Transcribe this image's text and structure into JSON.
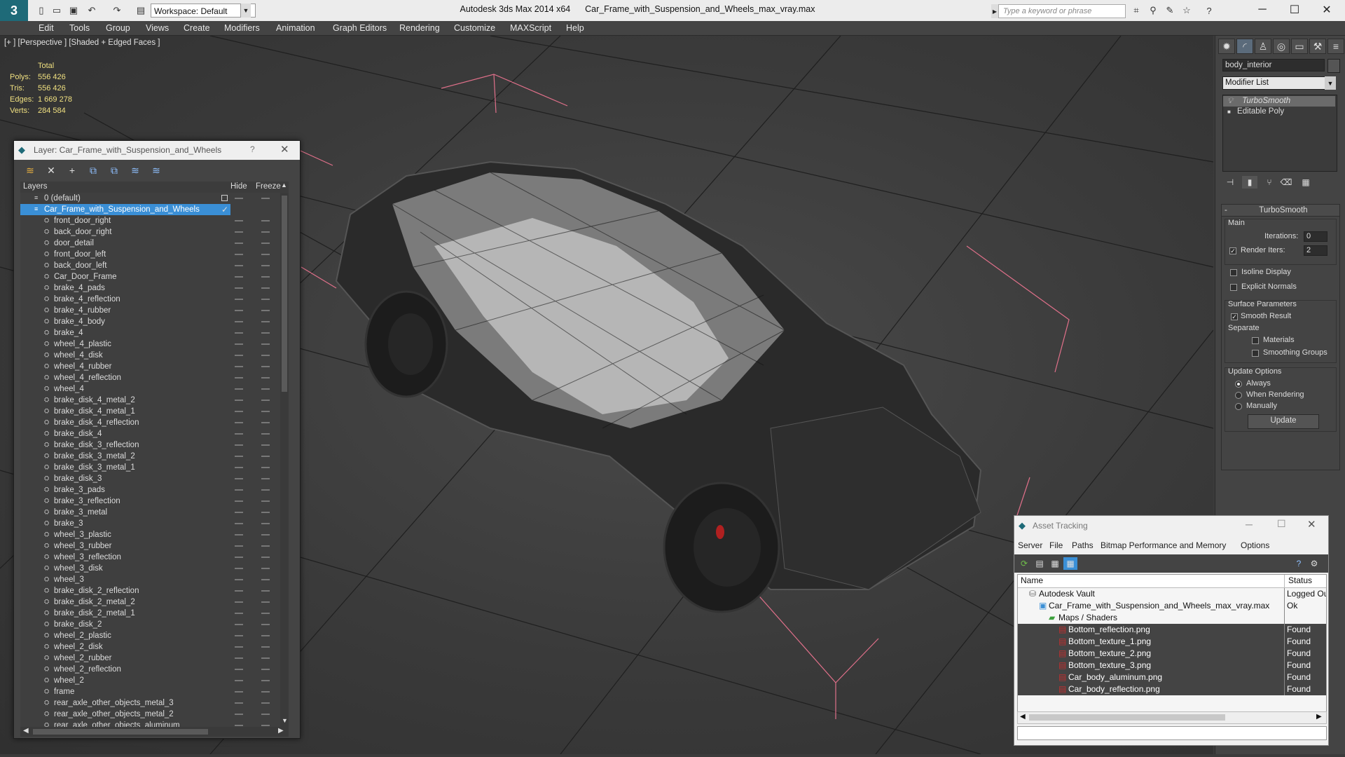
{
  "title_bar": {
    "app_name": "Autodesk 3ds Max  2014 x64",
    "file_name": "Car_Frame_with_Suspension_and_Wheels_max_vray.max",
    "workspace": "Workspace: Default",
    "search_placeholder": "Type a keyword or phrase"
  },
  "menu": [
    "Edit",
    "Tools",
    "Group",
    "Views",
    "Create",
    "Modifiers",
    "Animation",
    "Graph Editors",
    "Rendering",
    "Customize",
    "MAXScript",
    "Help"
  ],
  "viewport": {
    "label": "[+ ] [Perspective ] [Shaded + Edged Faces ]",
    "stats_header": "Total",
    "stats": [
      {
        "key": "Polys:",
        "value": "556 426"
      },
      {
        "key": "Tris:",
        "value": "556 426"
      },
      {
        "key": "Edges:",
        "value": "1 669 278"
      },
      {
        "key": "Verts:",
        "value": "284 584"
      }
    ]
  },
  "command_panel": {
    "object_name": "body_interior",
    "modifier_list": "Modifier List",
    "stack": [
      "TurboSmooth",
      "Editable Poly"
    ],
    "rollout_title": "TurboSmooth",
    "main_label": "Main",
    "iterations_label": "Iterations:",
    "iterations_value": "0",
    "render_iters_label": "Render Iters:",
    "render_iters_value": "2",
    "isoline_label": "Isoline Display",
    "explicit_normals_label": "Explicit Normals",
    "surface_params_label": "Surface Parameters",
    "smooth_result_label": "Smooth Result",
    "separate_label": "Separate",
    "materials_label": "Materials",
    "smoothing_groups_label": "Smoothing Groups",
    "update_options_label": "Update Options",
    "always_label": "Always",
    "when_rendering_label": "When Rendering",
    "manually_label": "Manually",
    "update_button": "Update"
  },
  "layer_dialog": {
    "title": "Layer: Car_Frame_with_Suspension_and_Wheels",
    "help": "?",
    "col_layers": "Layers",
    "col_hide": "Hide",
    "col_freeze": "Freeze",
    "default_layer": "0 (default)",
    "active_layer": "Car_Frame_with_Suspension_and_Wheels",
    "objects": [
      "front_door_right",
      "back_door_right",
      "door_detail",
      "front_door_left",
      "back_door_left",
      "Car_Door_Frame",
      "brake_4_pads",
      "brake_4_reflection",
      "brake_4_rubber",
      "brake_4_body",
      "brake_4",
      "wheel_4_plastic",
      "wheel_4_disk",
      "wheel_4_rubber",
      "wheel_4_reflection",
      "wheel_4",
      "brake_disk_4_metal_2",
      "brake_disk_4_metal_1",
      "brake_disk_4_reflection",
      "brake_disk_4",
      "brake_disk_3_reflection",
      "brake_disk_3_metal_2",
      "brake_disk_3_metal_1",
      "brake_disk_3",
      "brake_3_pads",
      "brake_3_reflection",
      "brake_3_metal",
      "brake_3",
      "wheel_3_plastic",
      "wheel_3_rubber",
      "wheel_3_reflection",
      "wheel_3_disk",
      "wheel_3",
      "brake_disk_2_reflection",
      "brake_disk_2_metal_2",
      "brake_disk_2_metal_1",
      "brake_disk_2",
      "wheel_2_plastic",
      "wheel_2_disk",
      "wheel_2_rubber",
      "wheel_2_reflection",
      "wheel_2",
      "frame",
      "rear_axle_other_objects_metal_3",
      "rear_axle_other_objects_metal_2",
      "rear_axle_other_objects_aluminum"
    ]
  },
  "asset_tracking": {
    "title": "Asset Tracking",
    "menu": [
      "Server",
      "File",
      "Paths",
      "Bitmap Performance and Memory",
      "Options"
    ],
    "col_name": "Name",
    "col_status": "Status",
    "rows": [
      {
        "name": "Autodesk Vault",
        "status": "Logged Out",
        "level": 0,
        "dark": false,
        "icon": "vault"
      },
      {
        "name": "Car_Frame_with_Suspension_and_Wheels_max_vray.max",
        "status": "Ok",
        "level": 1,
        "dark": false,
        "icon": "max"
      },
      {
        "name": "Maps / Shaders",
        "status": "",
        "level": 2,
        "dark": false,
        "icon": "maps"
      },
      {
        "name": "Bottom_reflection.png",
        "status": "Found",
        "level": 3,
        "dark": true,
        "icon": "png"
      },
      {
        "name": "Bottom_texture_1.png",
        "status": "Found",
        "level": 3,
        "dark": true,
        "icon": "png"
      },
      {
        "name": "Bottom_texture_2.png",
        "status": "Found",
        "level": 3,
        "dark": true,
        "icon": "png"
      },
      {
        "name": "Bottom_texture_3.png",
        "status": "Found",
        "level": 3,
        "dark": true,
        "icon": "png"
      },
      {
        "name": "Car_body_aluminum.png",
        "status": "Found",
        "level": 3,
        "dark": true,
        "icon": "png"
      },
      {
        "name": "Car_body_reflection.png",
        "status": "Found",
        "level": 3,
        "dark": true,
        "icon": "png"
      }
    ]
  },
  "colors": {
    "selection_blue": "#3a8fd6",
    "stats_yellow": "#f0e080",
    "bbox_pink": "#e0708a"
  }
}
